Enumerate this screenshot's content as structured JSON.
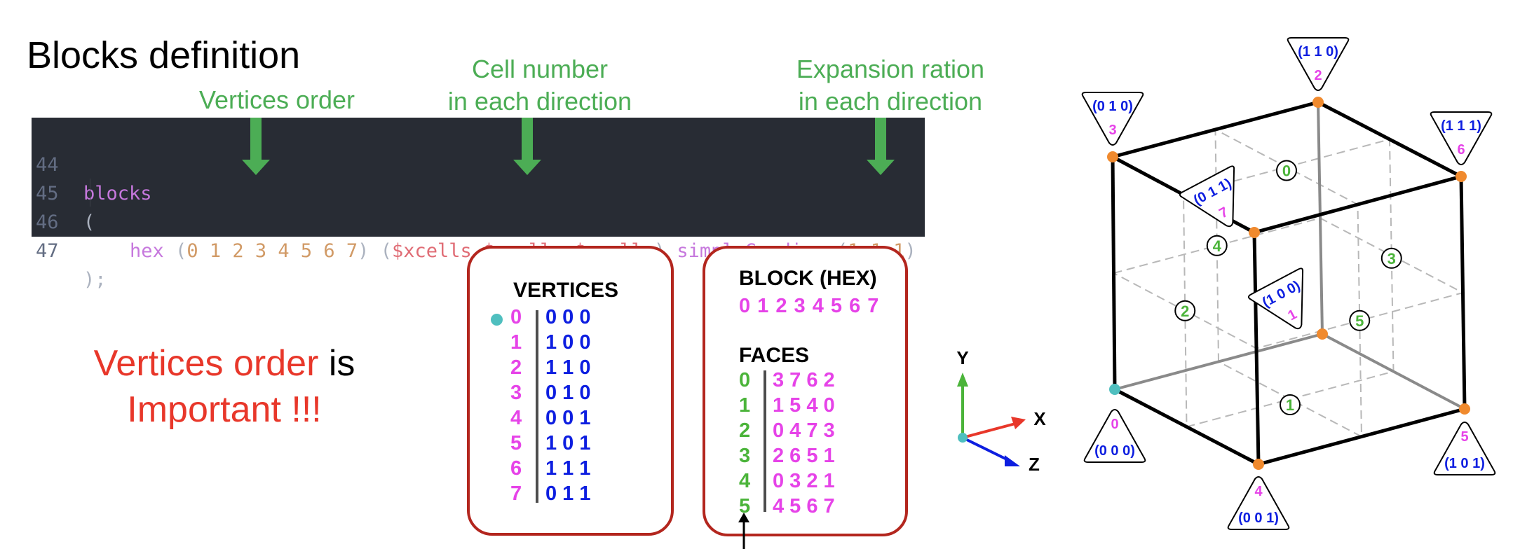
{
  "title": "Blocks definition",
  "annotations": {
    "vertices_order": "Vertices order",
    "cell_number_line1": "Cell number",
    "cell_number_line2": "in each direction",
    "expansion_line1": "Expansion ration",
    "expansion_line2": "in each direction"
  },
  "code": {
    "lines": [
      {
        "number": "44",
        "keyword": "blocks"
      },
      {
        "number": "45",
        "text": "("
      },
      {
        "number": "46",
        "keyword": "hex",
        "open1": "(",
        "vertices": "0 1 2 3 4 5 6 7",
        "close1": ")",
        "open2": "(",
        "cells": "$xcells $ycells $zcells",
        "close2": ")",
        "grading_keyword": "simpleGrading",
        "open3": "(",
        "grading": "1 1 1",
        "close3": ")"
      },
      {
        "number": "47",
        "text": ");"
      }
    ]
  },
  "warning": {
    "part1": "Vertices order",
    "part2": "is",
    "part3": "Important !!!"
  },
  "vertices_panel": {
    "heading": "VERTICES",
    "rows": [
      {
        "index": "0",
        "coords": "0 0 0"
      },
      {
        "index": "1",
        "coords": "1 0 0"
      },
      {
        "index": "2",
        "coords": "1 1 0"
      },
      {
        "index": "3",
        "coords": "0 1 0"
      },
      {
        "index": "4",
        "coords": "0 0 1"
      },
      {
        "index": "5",
        "coords": "1 0 1"
      },
      {
        "index": "6",
        "coords": "1 1 1"
      },
      {
        "index": "7",
        "coords": "0 1 1"
      }
    ]
  },
  "faces_panel": {
    "block_heading": "BLOCK (HEX)",
    "block_order": "0 1 2 3 4 5 6 7",
    "faces_heading": "FACES",
    "rows": [
      {
        "index": "0",
        "vertices": "3 7 6 2"
      },
      {
        "index": "1",
        "vertices": "1 5 4 0"
      },
      {
        "index": "2",
        "vertices": "0 4 7 3"
      },
      {
        "index": "3",
        "vertices": "2 6 5 1"
      },
      {
        "index": "4",
        "vertices": "0 3 2 1"
      },
      {
        "index": "5",
        "vertices": "4 5 6 7"
      }
    ]
  },
  "axes": {
    "x": "X",
    "y": "Y",
    "z": "Z"
  },
  "cube": {
    "vertices": [
      {
        "index": "0",
        "coords": "(0 0 0)"
      },
      {
        "index": "1",
        "coords": "(1 0 0)"
      },
      {
        "index": "2",
        "coords": "(1 1 0)"
      },
      {
        "index": "3",
        "coords": "(0 1 0)"
      },
      {
        "index": "4",
        "coords": "(0 0 1)"
      },
      {
        "index": "5",
        "coords": "(1 0 1)"
      },
      {
        "index": "6",
        "coords": "(1 1 1)"
      },
      {
        "index": "7",
        "coords": "(0 1 1)"
      }
    ],
    "faces": [
      "0",
      "1",
      "2",
      "3",
      "4",
      "5"
    ]
  },
  "colors": {
    "annotation_green": "#4cad55",
    "vertex_index_magenta": "#e643e8",
    "coords_blue": "#0d1ee0",
    "face_green": "#4bb43a",
    "panel_border": "#b3261e",
    "warning_red": "#e8372a",
    "origin_teal": "#4fbfbf",
    "vertex_orange": "#f08a2e",
    "code_bg": "#282c34"
  }
}
